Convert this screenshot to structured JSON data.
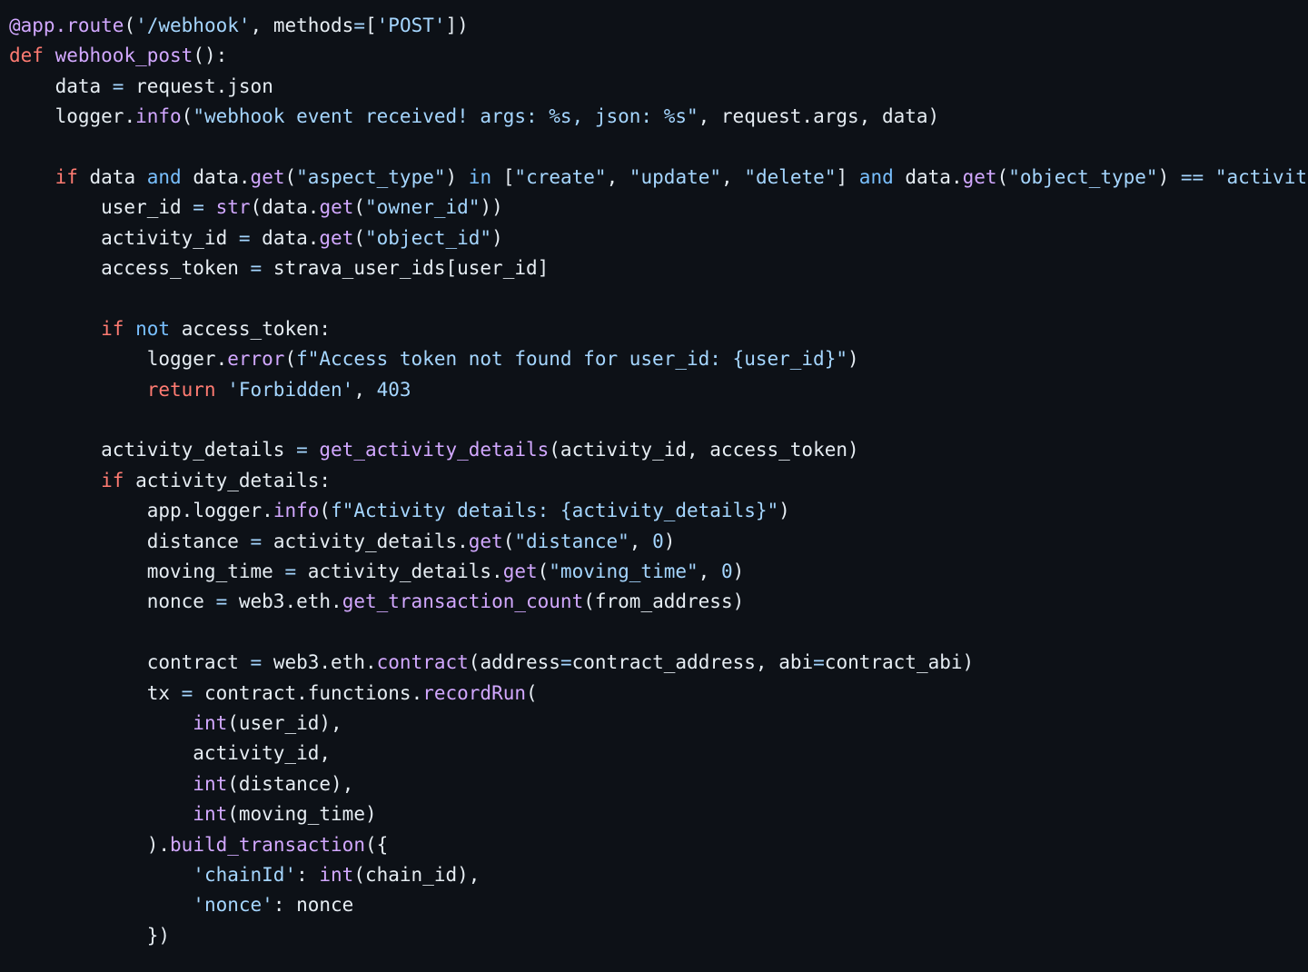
{
  "editor": {
    "language": "Python",
    "theme": "github-dark",
    "background_color": "#0d1117",
    "colors": {
      "foreground": "#e6edf3",
      "keyword": "#ff7b72",
      "operator_keyword": "#79c0ff",
      "function": "#d2a8ff",
      "string": "#a5d6ff",
      "number": "#a5d6ff",
      "operator": "#a5d6ff",
      "decorator": "#d2a8ff"
    }
  },
  "code": {
    "lines": [
      "@app.route('/webhook', methods=['POST'])",
      "def webhook_post():",
      "    data = request.json",
      "    logger.info(\"webhook event received! args: %s, json: %s\", request.args, data)",
      "",
      "    if data and data.get(\"aspect_type\") in [\"create\", \"update\", \"delete\"] and data.get(\"object_type\") == \"activity\":",
      "        user_id = str(data.get(\"owner_id\"))",
      "        activity_id = data.get(\"object_id\")",
      "        access_token = strava_user_ids[user_id]",
      "",
      "        if not access_token:",
      "            logger.error(f\"Access token not found for user_id: {user_id}\")",
      "            return 'Forbidden', 403",
      "",
      "        activity_details = get_activity_details(activity_id, access_token)",
      "        if activity_details:",
      "            app.logger.info(f\"Activity details: {activity_details}\")",
      "            distance = activity_details.get(\"distance\", 0)",
      "            moving_time = activity_details.get(\"moving_time\", 0)",
      "            nonce = web3.eth.get_transaction_count(from_address)",
      "",
      "            contract = web3.eth.contract(address=contract_address, abi=contract_abi)",
      "            tx = contract.functions.recordRun(",
      "                int(user_id),",
      "                activity_id,",
      "                int(distance),",
      "                int(moving_time)",
      "            ).build_transaction({",
      "                'chainId': int(chain_id),",
      "                'nonce': nonce",
      "            })"
    ],
    "tokens": [
      [
        [
          "@app.route",
          "t-dec"
        ],
        [
          "(",
          "t-punct"
        ],
        [
          "'/webhook'",
          "t-str"
        ],
        [
          ", ",
          "t-punct"
        ],
        [
          "methods",
          "t-plain"
        ],
        [
          "=",
          "t-op"
        ],
        [
          "[",
          "t-punct"
        ],
        [
          "'POST'",
          "t-str"
        ],
        [
          "])",
          "t-punct"
        ]
      ],
      [
        [
          "def",
          "t-kw"
        ],
        [
          " ",
          "t-plain"
        ],
        [
          "webhook_post",
          "t-fn"
        ],
        [
          "():",
          "t-punct"
        ]
      ],
      [
        [
          "    data ",
          "t-plain"
        ],
        [
          "=",
          "t-op"
        ],
        [
          " request",
          "t-plain"
        ],
        [
          ".",
          "t-punct"
        ],
        [
          "json",
          "t-plain"
        ]
      ],
      [
        [
          "    logger",
          "t-plain"
        ],
        [
          ".",
          "t-punct"
        ],
        [
          "info",
          "t-fn"
        ],
        [
          "(",
          "t-punct"
        ],
        [
          "\"webhook event received! args: %s, json: %s\"",
          "t-str"
        ],
        [
          ", request",
          "t-plain"
        ],
        [
          ".",
          "t-punct"
        ],
        [
          "args",
          "t-plain"
        ],
        [
          ", data",
          "t-plain"
        ],
        [
          ")",
          "t-punct"
        ]
      ],
      [],
      [
        [
          "    ",
          "t-plain"
        ],
        [
          "if",
          "t-kw"
        ],
        [
          " data ",
          "t-plain"
        ],
        [
          "and",
          "t-op-kw"
        ],
        [
          " data",
          "t-plain"
        ],
        [
          ".",
          "t-punct"
        ],
        [
          "get",
          "t-fn"
        ],
        [
          "(",
          "t-punct"
        ],
        [
          "\"aspect_type\"",
          "t-str"
        ],
        [
          ")",
          "t-punct"
        ],
        [
          " ",
          "t-plain"
        ],
        [
          "in",
          "t-op-kw"
        ],
        [
          " [",
          "t-punct"
        ],
        [
          "\"create\"",
          "t-str"
        ],
        [
          ", ",
          "t-punct"
        ],
        [
          "\"update\"",
          "t-str"
        ],
        [
          ", ",
          "t-punct"
        ],
        [
          "\"delete\"",
          "t-str"
        ],
        [
          "]",
          "t-punct"
        ],
        [
          " ",
          "t-plain"
        ],
        [
          "and",
          "t-op-kw"
        ],
        [
          " data",
          "t-plain"
        ],
        [
          ".",
          "t-punct"
        ],
        [
          "get",
          "t-fn"
        ],
        [
          "(",
          "t-punct"
        ],
        [
          "\"object_type\"",
          "t-str"
        ],
        [
          ")",
          "t-punct"
        ],
        [
          " ",
          "t-plain"
        ],
        [
          "==",
          "t-op"
        ],
        [
          " ",
          "t-plain"
        ],
        [
          "\"activity\"",
          "t-str"
        ],
        [
          ":",
          "t-punct"
        ]
      ],
      [
        [
          "        user_id ",
          "t-plain"
        ],
        [
          "=",
          "t-op"
        ],
        [
          " ",
          "t-plain"
        ],
        [
          "str",
          "t-fn"
        ],
        [
          "(",
          "t-punct"
        ],
        [
          "data",
          "t-plain"
        ],
        [
          ".",
          "t-punct"
        ],
        [
          "get",
          "t-fn"
        ],
        [
          "(",
          "t-punct"
        ],
        [
          "\"owner_id\"",
          "t-str"
        ],
        [
          "))",
          "t-punct"
        ]
      ],
      [
        [
          "        activity_id ",
          "t-plain"
        ],
        [
          "=",
          "t-op"
        ],
        [
          " data",
          "t-plain"
        ],
        [
          ".",
          "t-punct"
        ],
        [
          "get",
          "t-fn"
        ],
        [
          "(",
          "t-punct"
        ],
        [
          "\"object_id\"",
          "t-str"
        ],
        [
          ")",
          "t-punct"
        ]
      ],
      [
        [
          "        access_token ",
          "t-plain"
        ],
        [
          "=",
          "t-op"
        ],
        [
          " strava_user_ids",
          "t-plain"
        ],
        [
          "[",
          "t-punct"
        ],
        [
          "user_id",
          "t-plain"
        ],
        [
          "]",
          "t-punct"
        ]
      ],
      [],
      [
        [
          "        ",
          "t-plain"
        ],
        [
          "if",
          "t-kw"
        ],
        [
          " ",
          "t-plain"
        ],
        [
          "not",
          "t-op-kw"
        ],
        [
          " access_token",
          "t-plain"
        ],
        [
          ":",
          "t-punct"
        ]
      ],
      [
        [
          "            logger",
          "t-plain"
        ],
        [
          ".",
          "t-punct"
        ],
        [
          "error",
          "t-fn"
        ],
        [
          "(",
          "t-punct"
        ],
        [
          "f\"Access token not found for user_id: {user_id}\"",
          "t-str"
        ],
        [
          ")",
          "t-punct"
        ]
      ],
      [
        [
          "            ",
          "t-plain"
        ],
        [
          "return",
          "t-kw"
        ],
        [
          " ",
          "t-plain"
        ],
        [
          "'Forbidden'",
          "t-str"
        ],
        [
          ", ",
          "t-punct"
        ],
        [
          "403",
          "t-num"
        ]
      ],
      [],
      [
        [
          "        activity_details ",
          "t-plain"
        ],
        [
          "=",
          "t-op"
        ],
        [
          " ",
          "t-plain"
        ],
        [
          "get_activity_details",
          "t-fn"
        ],
        [
          "(",
          "t-punct"
        ],
        [
          "activity_id, access_token",
          "t-plain"
        ],
        [
          ")",
          "t-punct"
        ]
      ],
      [
        [
          "        ",
          "t-plain"
        ],
        [
          "if",
          "t-kw"
        ],
        [
          " activity_details",
          "t-plain"
        ],
        [
          ":",
          "t-punct"
        ]
      ],
      [
        [
          "            app",
          "t-plain"
        ],
        [
          ".",
          "t-punct"
        ],
        [
          "logger",
          "t-plain"
        ],
        [
          ".",
          "t-punct"
        ],
        [
          "info",
          "t-fn"
        ],
        [
          "(",
          "t-punct"
        ],
        [
          "f\"Activity details: {activity_details}\"",
          "t-str"
        ],
        [
          ")",
          "t-punct"
        ]
      ],
      [
        [
          "            distance ",
          "t-plain"
        ],
        [
          "=",
          "t-op"
        ],
        [
          " activity_details",
          "t-plain"
        ],
        [
          ".",
          "t-punct"
        ],
        [
          "get",
          "t-fn"
        ],
        [
          "(",
          "t-punct"
        ],
        [
          "\"distance\"",
          "t-str"
        ],
        [
          ", ",
          "t-punct"
        ],
        [
          "0",
          "t-num"
        ],
        [
          ")",
          "t-punct"
        ]
      ],
      [
        [
          "            moving_time ",
          "t-plain"
        ],
        [
          "=",
          "t-op"
        ],
        [
          " activity_details",
          "t-plain"
        ],
        [
          ".",
          "t-punct"
        ],
        [
          "get",
          "t-fn"
        ],
        [
          "(",
          "t-punct"
        ],
        [
          "\"moving_time\"",
          "t-str"
        ],
        [
          ", ",
          "t-punct"
        ],
        [
          "0",
          "t-num"
        ],
        [
          ")",
          "t-punct"
        ]
      ],
      [
        [
          "            nonce ",
          "t-plain"
        ],
        [
          "=",
          "t-op"
        ],
        [
          " web3",
          "t-plain"
        ],
        [
          ".",
          "t-punct"
        ],
        [
          "eth",
          "t-plain"
        ],
        [
          ".",
          "t-punct"
        ],
        [
          "get_transaction_count",
          "t-fn"
        ],
        [
          "(",
          "t-punct"
        ],
        [
          "from_address",
          "t-plain"
        ],
        [
          ")",
          "t-punct"
        ]
      ],
      [],
      [
        [
          "            contract ",
          "t-plain"
        ],
        [
          "=",
          "t-op"
        ],
        [
          " web3",
          "t-plain"
        ],
        [
          ".",
          "t-punct"
        ],
        [
          "eth",
          "t-plain"
        ],
        [
          ".",
          "t-punct"
        ],
        [
          "contract",
          "t-fn"
        ],
        [
          "(",
          "t-punct"
        ],
        [
          "address",
          "t-plain"
        ],
        [
          "=",
          "t-op"
        ],
        [
          "contract_address, abi",
          "t-plain"
        ],
        [
          "=",
          "t-op"
        ],
        [
          "contract_abi",
          "t-plain"
        ],
        [
          ")",
          "t-punct"
        ]
      ],
      [
        [
          "            tx ",
          "t-plain"
        ],
        [
          "=",
          "t-op"
        ],
        [
          " contract",
          "t-plain"
        ],
        [
          ".",
          "t-punct"
        ],
        [
          "functions",
          "t-plain"
        ],
        [
          ".",
          "t-punct"
        ],
        [
          "recordRun",
          "t-fn"
        ],
        [
          "(",
          "t-punct"
        ]
      ],
      [
        [
          "                ",
          "t-plain"
        ],
        [
          "int",
          "t-fn"
        ],
        [
          "(",
          "t-punct"
        ],
        [
          "user_id",
          "t-plain"
        ],
        [
          "),",
          "t-punct"
        ]
      ],
      [
        [
          "                activity_id",
          "t-plain"
        ],
        [
          ",",
          "t-punct"
        ]
      ],
      [
        [
          "                ",
          "t-plain"
        ],
        [
          "int",
          "t-fn"
        ],
        [
          "(",
          "t-punct"
        ],
        [
          "distance",
          "t-plain"
        ],
        [
          "),",
          "t-punct"
        ]
      ],
      [
        [
          "                ",
          "t-plain"
        ],
        [
          "int",
          "t-fn"
        ],
        [
          "(",
          "t-punct"
        ],
        [
          "moving_time",
          "t-plain"
        ],
        [
          ")",
          "t-punct"
        ]
      ],
      [
        [
          "            )",
          "t-punct"
        ],
        [
          ".",
          "t-punct"
        ],
        [
          "build_transaction",
          "t-fn"
        ],
        [
          "({",
          "t-punct"
        ]
      ],
      [
        [
          "                ",
          "t-plain"
        ],
        [
          "'chainId'",
          "t-str"
        ],
        [
          ": ",
          "t-punct"
        ],
        [
          "int",
          "t-fn"
        ],
        [
          "(",
          "t-punct"
        ],
        [
          "chain_id",
          "t-plain"
        ],
        [
          "),",
          "t-punct"
        ]
      ],
      [
        [
          "                ",
          "t-plain"
        ],
        [
          "'nonce'",
          "t-str"
        ],
        [
          ": ",
          "t-punct"
        ],
        [
          "nonce",
          "t-plain"
        ]
      ],
      [
        [
          "            })",
          "t-punct"
        ]
      ]
    ]
  }
}
